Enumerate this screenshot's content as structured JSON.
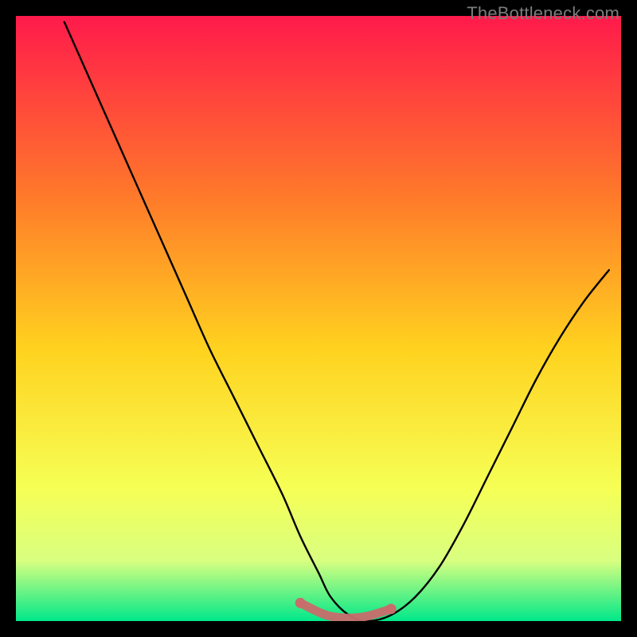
{
  "watermark": "TheBottleneck.com",
  "gradient": {
    "top_color": "#ff1a4b",
    "upper_mid_color": "#ff7a2a",
    "mid_color": "#ffd21f",
    "lower_mid_color": "#f6ff55",
    "near_bottom_color": "#d9ff80",
    "bottom_color": "#00e88a"
  },
  "curve": {
    "stroke": "#000000",
    "highlight_stroke": "#c96c6c"
  },
  "chart_data": {
    "type": "line",
    "title": "",
    "xlabel": "",
    "ylabel": "",
    "xlim": [
      0,
      100
    ],
    "ylim": [
      0,
      100
    ],
    "annotations": [
      "TheBottleneck.com"
    ],
    "series": [
      {
        "name": "bottleneck-curve",
        "x": [
          8,
          12,
          16,
          20,
          24,
          28,
          32,
          36,
          40,
          44,
          47,
          50,
          52,
          55,
          58,
          62,
          66,
          70,
          74,
          78,
          82,
          86,
          90,
          94,
          98
        ],
        "y": [
          99,
          90,
          81,
          72,
          63,
          54,
          45,
          37,
          29,
          21,
          14,
          8,
          4,
          1,
          0,
          1,
          4,
          9,
          16,
          24,
          32,
          40,
          47,
          53,
          58
        ]
      },
      {
        "name": "highlight-segment",
        "x": [
          47,
          50,
          52,
          55,
          58,
          62
        ],
        "y": [
          3,
          1.5,
          0.8,
          0.5,
          0.8,
          2
        ]
      }
    ],
    "background_gradient_stops": [
      {
        "offset": 0.0,
        "color": "#ff1a4b"
      },
      {
        "offset": 0.3,
        "color": "#ff7a2a"
      },
      {
        "offset": 0.55,
        "color": "#ffd21f"
      },
      {
        "offset": 0.78,
        "color": "#f6ff55"
      },
      {
        "offset": 0.9,
        "color": "#d9ff80"
      },
      {
        "offset": 1.0,
        "color": "#00e88a"
      }
    ]
  }
}
